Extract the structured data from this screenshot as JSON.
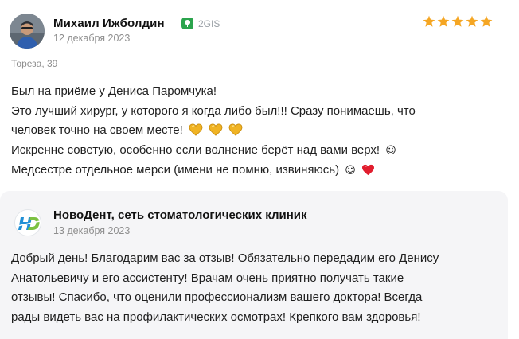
{
  "review": {
    "author": "Михаил Ижболдин",
    "source": "2GIS",
    "date": "12 декабря 2023",
    "rating": 5,
    "branch": "Тореза, 39",
    "lines": [
      "Был на приёме у Дениса Паромчука!",
      "Это лучший хирург, у которого я когда либо был!!! Сразу понимаешь, что",
      "человек точно на своем месте!",
      "Искренне советую, особенно если волнение берёт над вами верх!",
      "Медсестре отдельное мерси (имени не помню, извиняюсь)"
    ],
    "smile": "☺",
    "colors": {
      "star": "#f5a623",
      "heart": "#e11d2e",
      "emoji_heart": "#f0b323"
    }
  },
  "reply": {
    "org_name": "НовоДент, сеть стоматологических клиник",
    "date": "13 декабря 2023",
    "lines": [
      "Добрый день! Благодарим вас за отзыв! Обязательно передадим его Денису",
      "Анатольевичу и его ассистенту! Врачам очень приятно получать такие",
      "отзывы! Спасибо, что оценили профессионализм вашего доктора! Всегда",
      "рады видеть вас на профилактических осмотрах! Крепкого вам здоровья!"
    ],
    "colors": {
      "logo": "#1f8fd6",
      "background": "#f5f5f7"
    }
  }
}
